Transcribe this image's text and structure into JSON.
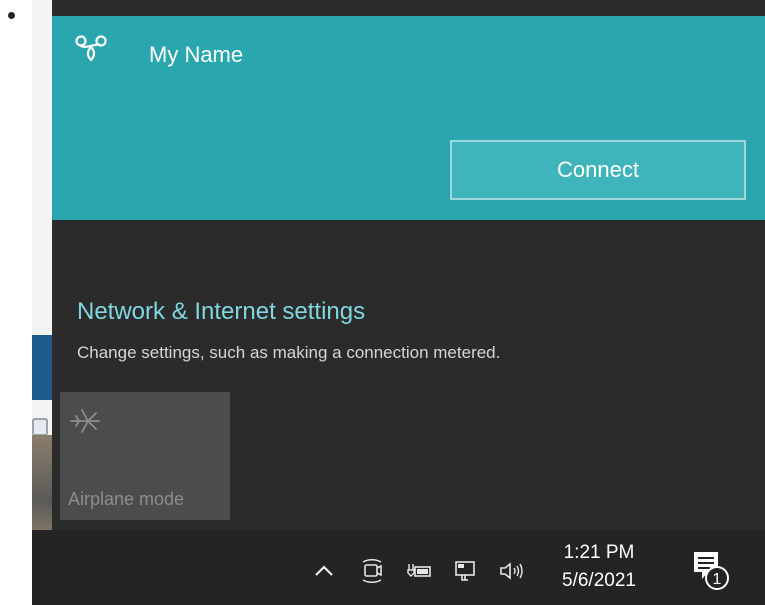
{
  "network": {
    "name": "My Name",
    "connect_label": "Connect",
    "icon": "hotspot-network-icon"
  },
  "settings": {
    "link_label": "Network & Internet settings",
    "description": "Change settings, such as making a connection metered."
  },
  "quick_actions": [
    {
      "label": "Airplane mode",
      "icon": "airplane-icon",
      "state": "off"
    }
  ],
  "taskbar": {
    "tray_icons": [
      "chevron-up-icon",
      "meet-now-icon",
      "battery-charging-icon",
      "network-wired-icon",
      "speaker-icon"
    ],
    "time": "1:21 PM",
    "date": "5/6/2021",
    "notification_count": "1"
  },
  "colors": {
    "accent": "#2aa7ae",
    "flyout_bg": "#2b2b2b",
    "taskbar_bg": "#242424",
    "link": "#7fd7df"
  }
}
